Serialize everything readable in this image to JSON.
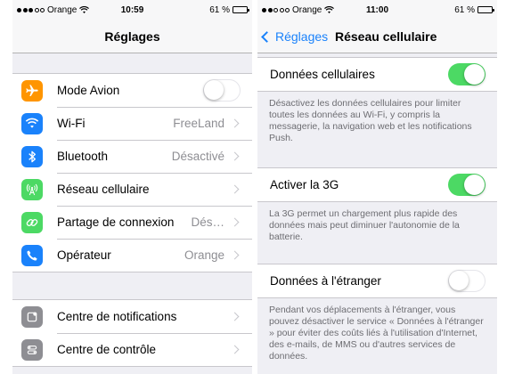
{
  "colors": {
    "accent": "#1a82fb",
    "toggle_on": "#4cd964",
    "background": "#efeff4"
  },
  "left": {
    "status": {
      "carrier": "Orange",
      "time": "10:59",
      "battery": "61 %",
      "battery_level": 0.61
    },
    "title": "Réglages",
    "group1": [
      {
        "label": "Mode Avion",
        "icon": "airplane-icon",
        "icon_color": "#ff9500",
        "control": "toggle",
        "on": false
      },
      {
        "label": "Wi-Fi",
        "icon": "wifi-icon",
        "icon_color": "#1a82fb",
        "value": "FreeLand"
      },
      {
        "label": "Bluetooth",
        "icon": "bluetooth-icon",
        "icon_color": "#1a82fb",
        "value": "Désactivé"
      },
      {
        "label": "Réseau cellulaire",
        "icon": "antenna-icon",
        "icon_color": "#4cd964"
      },
      {
        "label": "Partage de connexion",
        "icon": "chain-link-icon",
        "icon_color": "#4cd964",
        "value": "Dés…"
      },
      {
        "label": "Opérateur",
        "icon": "phone-icon",
        "icon_color": "#1a82fb",
        "value": "Orange"
      }
    ],
    "group2": [
      {
        "label": "Centre de notifications",
        "icon": "notifications-icon",
        "icon_color": "#8e8e93"
      },
      {
        "label": "Centre de contrôle",
        "icon": "control-center-icon",
        "icon_color": "#8e8e93"
      }
    ]
  },
  "right": {
    "status": {
      "carrier": "Orange",
      "time": "11:00",
      "battery": "61 %",
      "battery_level": 0.61
    },
    "back_label": "Réglages",
    "title": "Réseau cellulaire",
    "cellular_data": {
      "label": "Données cellulaires",
      "on": true
    },
    "cellular_note": "Désactivez les données cellulaires pour limiter toutes les données au Wi-Fi, y compris la messagerie, la navigation web et les notifications Push.",
    "enable_3g": {
      "label": "Activer la 3G",
      "on": true
    },
    "3g_note": "La 3G permet un chargement plus rapide des données mais peut diminuer l'autonomie de la batterie.",
    "roaming": {
      "label": "Données à l'étranger",
      "on": false
    },
    "roaming_note": "Pendant vos déplacements à l'étranger, vous pouvez désactiver le service « Données à l'étranger » pour éviter des coûts liés à l'utilisation d'Internet, des e-mails, de MMS ou d'autres services de données."
  }
}
